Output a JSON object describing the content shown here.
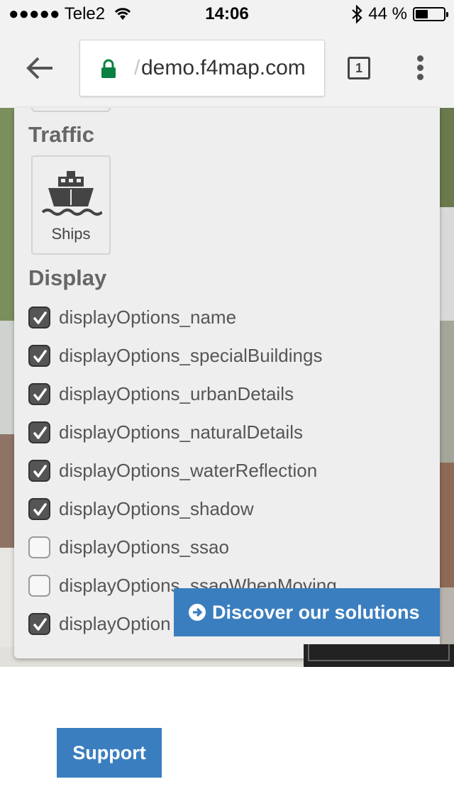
{
  "status_bar": {
    "carrier": "●●●●● Tele2",
    "time": "14:06",
    "battery_text": "44 %",
    "battery_level": 0.44
  },
  "browser": {
    "url": "demo.f4map.com",
    "url_prefix_faded": "/",
    "tab_count": "1"
  },
  "panel": {
    "traffic_title": "Traffic",
    "traffic_items": [
      {
        "label": "Ships",
        "icon": "ship-icon"
      }
    ],
    "display_title": "Display",
    "display_options": [
      {
        "label": "displayOptions_name",
        "checked": true
      },
      {
        "label": "displayOptions_specialBuildings",
        "checked": true
      },
      {
        "label": "displayOptions_urbanDetails",
        "checked": true
      },
      {
        "label": "displayOptions_naturalDetails",
        "checked": true
      },
      {
        "label": "displayOptions_waterReflection",
        "checked": true
      },
      {
        "label": "displayOptions_shadow",
        "checked": true
      },
      {
        "label": "displayOptions_ssao",
        "checked": false
      },
      {
        "label": "displayOptions_ssaoWhenMoving",
        "checked": false
      },
      {
        "label": "displayOption",
        "checked": true
      }
    ]
  },
  "cta": {
    "discover_label": "Discover our solutions",
    "support_label": "Support"
  },
  "colors": {
    "accent": "#3a7ebf",
    "panel_bg": "#eeeeee",
    "secure_lock": "#0b8043"
  }
}
